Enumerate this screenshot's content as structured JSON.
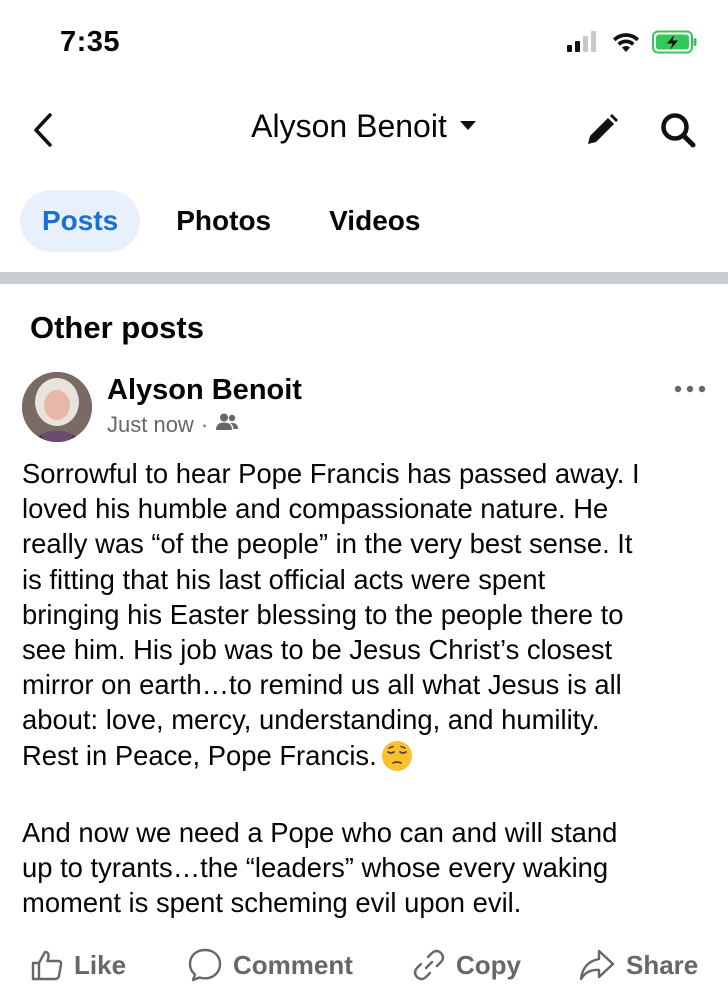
{
  "status_bar": {
    "time": "7:35",
    "icons": [
      "cellular-signal-icon",
      "wifi-icon",
      "battery-charging-icon"
    ],
    "battery_color": "#34c759"
  },
  "header": {
    "title": "Alyson Benoit",
    "icons": [
      "back-chevron-icon",
      "caret-down-icon",
      "pencil-icon",
      "search-icon"
    ]
  },
  "tabs": [
    {
      "label": "Posts",
      "active": true
    },
    {
      "label": "Photos",
      "active": false
    },
    {
      "label": "Videos",
      "active": false
    }
  ],
  "section": {
    "title": "Other posts"
  },
  "post": {
    "author": "Alyson Benoit",
    "time": "Just now",
    "separator": "·",
    "audience_icon": "friends-icon",
    "more_icon": "more-horizontal-icon",
    "body_lines": [
      "Sorrowful to hear Pope Francis has passed away. I",
      "loved his humble and compassionate nature. He",
      "really was “of the people” in the very best sense. It",
      "is fitting that his last official acts were spent",
      "bringing his Easter blessing to the people there to",
      "see him. His job was to be Jesus Christ’s closest",
      "mirror on earth…to remind us all what Jesus is all",
      "about: love, mercy, understanding, and humility.",
      "Rest in Peace, Pope Francis."
    ],
    "emoji": "pensive-face-emoji",
    "body_lines_2": [
      "And now we need a Pope who can and will stand",
      "up to tyrants…the “leaders” whose every waking",
      "moment is spent scheming evil upon evil."
    ]
  },
  "actions": [
    {
      "label": "Like",
      "icon": "thumbs-up-icon"
    },
    {
      "label": "Comment",
      "icon": "comment-bubble-icon"
    },
    {
      "label": "Copy",
      "icon": "link-icon"
    },
    {
      "label": "Share",
      "icon": "share-arrow-icon"
    }
  ],
  "colors": {
    "accent": "#1a6ed8",
    "active_tab_bg": "#e7f0fb",
    "secondary_text": "#65676b",
    "divider": "#c9ccd1"
  }
}
